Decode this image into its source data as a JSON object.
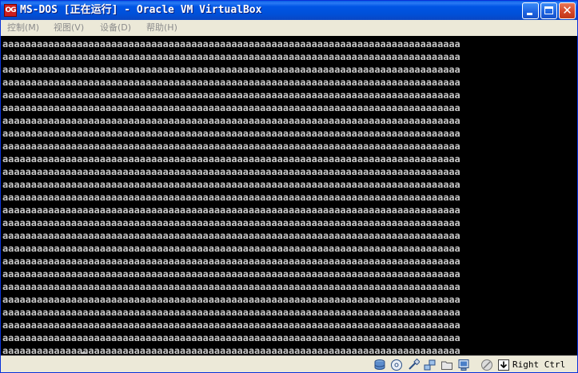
{
  "window": {
    "app_icon_text": "OG",
    "title": "MS-DOS [正在运行] - Oracle VM VirtualBox"
  },
  "menubar": {
    "items": [
      {
        "label": "控制(M)"
      },
      {
        "label": "视图(V)"
      },
      {
        "label": "设备(D)"
      },
      {
        "label": "帮助(H)"
      }
    ]
  },
  "screen": {
    "lines": [
      "aaaaaaaaaaaaaaaaaaaaaaaaaaaaaaaaaaaaaaaaaaaaaaaaaaaaaaaaaaaaaaaaaaaaaaaaaaaaaaaa",
      "aaaaaaaaaaaaaaaaaaaaaaaaaaaaaaaaaaaaaaaaaaaaaaaaaaaaaaaaaaaaaaaaaaaaaaaaaaaaaaaa",
      "aaaaaaaaaaaaaaaaaaaaaaaaaaaaaaaaaaaaaaaaaaaaaaaaaaaaaaaaaaaaaaaaaaaaaaaaaaaaaaaa",
      "aaaaaaaaaaaaaaaaaaaaaaaaaaaaaaaaaaaaaaaaaaaaaaaaaaaaaaaaaaaaaaaaaaaaaaaaaaaaaaaa",
      "aaaaaaaaaaaaaaaaaaaaaaaaaaaaaaaaaaaaaaaaaaaaaaaaaaaaaaaaaaaaaaaaaaaaaaaaaaaaaaaa",
      "aaaaaaaaaaaaaaaaaaaaaaaaaaaaaaaaaaaaaaaaaaaaaaaaaaaaaaaaaaaaaaaaaaaaaaaaaaaaaaaa",
      "aaaaaaaaaaaaaaaaaaaaaaaaaaaaaaaaaaaaaaaaaaaaaaaaaaaaaaaaaaaaaaaaaaaaaaaaaaaaaaaa",
      "aaaaaaaaaaaaaaaaaaaaaaaaaaaaaaaaaaaaaaaaaaaaaaaaaaaaaaaaaaaaaaaaaaaaaaaaaaaaaaaa",
      "aaaaaaaaaaaaaaaaaaaaaaaaaaaaaaaaaaaaaaaaaaaaaaaaaaaaaaaaaaaaaaaaaaaaaaaaaaaaaaaa",
      "aaaaaaaaaaaaaaaaaaaaaaaaaaaaaaaaaaaaaaaaaaaaaaaaaaaaaaaaaaaaaaaaaaaaaaaaaaaaaaaa",
      "aaaaaaaaaaaaaaaaaaaaaaaaaaaaaaaaaaaaaaaaaaaaaaaaaaaaaaaaaaaaaaaaaaaaaaaaaaaaaaaa",
      "aaaaaaaaaaaaaaaaaaaaaaaaaaaaaaaaaaaaaaaaaaaaaaaaaaaaaaaaaaaaaaaaaaaaaaaaaaaaaaaa",
      "aaaaaaaaaaaaaaaaaaaaaaaaaaaaaaaaaaaaaaaaaaaaaaaaaaaaaaaaaaaaaaaaaaaaaaaaaaaaaaaa",
      "aaaaaaaaaaaaaaaaaaaaaaaaaaaaaaaaaaaaaaaaaaaaaaaaaaaaaaaaaaaaaaaaaaaaaaaaaaaaaaaa",
      "aaaaaaaaaaaaaaaaaaaaaaaaaaaaaaaaaaaaaaaaaaaaaaaaaaaaaaaaaaaaaaaaaaaaaaaaaaaaaaaa",
      "aaaaaaaaaaaaaaaaaaaaaaaaaaaaaaaaaaaaaaaaaaaaaaaaaaaaaaaaaaaaaaaaaaaaaaaaaaaaaaaa",
      "aaaaaaaaaaaaaaaaaaaaaaaaaaaaaaaaaaaaaaaaaaaaaaaaaaaaaaaaaaaaaaaaaaaaaaaaaaaaaaaa",
      "aaaaaaaaaaaaaaaaaaaaaaaaaaaaaaaaaaaaaaaaaaaaaaaaaaaaaaaaaaaaaaaaaaaaaaaaaaaaaaaa",
      "aaaaaaaaaaaaaaaaaaaaaaaaaaaaaaaaaaaaaaaaaaaaaaaaaaaaaaaaaaaaaaaaaaaaaaaaaaaaaaaa",
      "aaaaaaaaaaaaaaaaaaaaaaaaaaaaaaaaaaaaaaaaaaaaaaaaaaaaaaaaaaaaaaaaaaaaaaaaaaaaaaaa",
      "aaaaaaaaaaaaaaaaaaaaaaaaaaaaaaaaaaaaaaaaaaaaaaaaaaaaaaaaaaaaaaaaaaaaaaaaaaaaaaaa",
      "aaaaaaaaaaaaaaaaaaaaaaaaaaaaaaaaaaaaaaaaaaaaaaaaaaaaaaaaaaaaaaaaaaaaaaaaaaaaaaaa",
      "aaaaaaaaaaaaaaaaaaaaaaaaaaaaaaaaaaaaaaaaaaaaaaaaaaaaaaaaaaaaaaaaaaaaaaaaaaaaaaaa",
      "aaaaaaaaaaaaaaaaaaaaaaaaaaaaaaaaaaaaaaaaaaaaaaaaaaaaaaaaaaaaaaaaaaaaaaaaaaaaaaaa",
      "aaaaaaaaaaaaaaaaaaaaaaaaaaaaaaaaaaaaaaaaaaaaaaaaaaaaaaaaaaaaaaaaaaaaaaaaaaaaaaaa"
    ]
  },
  "statusbar": {
    "icons": [
      {
        "name": "hard-disk-icon",
        "interactive": true
      },
      {
        "name": "optical-drive-icon",
        "interactive": true
      },
      {
        "name": "usb-icon",
        "interactive": true
      },
      {
        "name": "network-icon",
        "interactive": true
      },
      {
        "name": "shared-folders-icon",
        "interactive": true
      },
      {
        "name": "display-icon",
        "interactive": true
      },
      {
        "name": "mouse-integration-icon",
        "interactive": true
      },
      {
        "name": "keyboard-capture-icon",
        "interactive": false
      }
    ],
    "host_key": "Right Ctrl"
  },
  "colors": {
    "titlebar": "#0055e5",
    "screen_bg": "#000000",
    "screen_text": "#c8c8c8",
    "menu_text_disabled": "#8c8c8c",
    "chrome": "#ece9d8"
  }
}
